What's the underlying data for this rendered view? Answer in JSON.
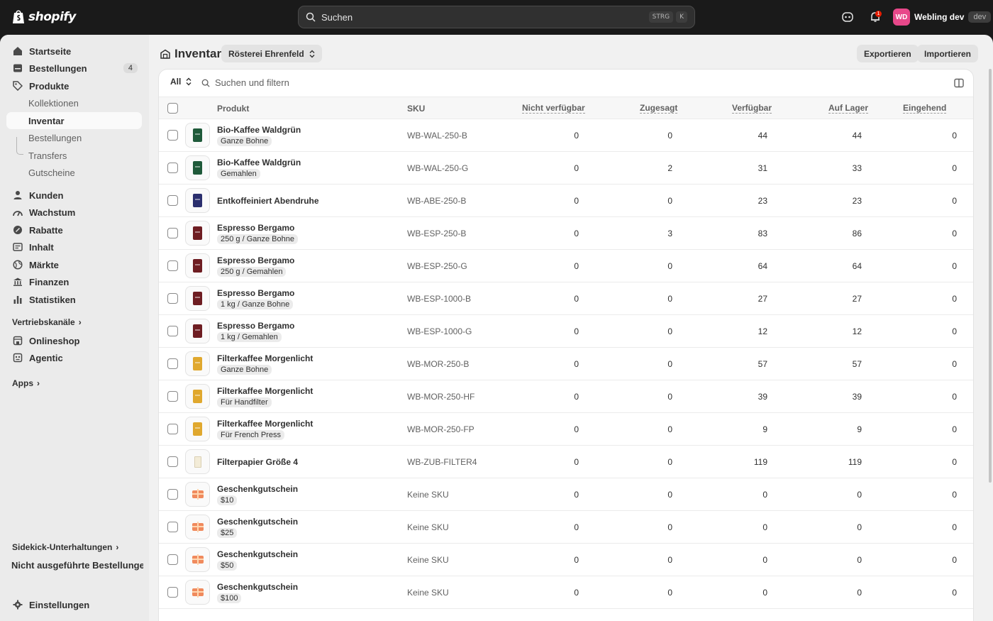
{
  "topbar": {
    "brand": "shopify",
    "search_placeholder": "Suchen",
    "shortcut_keys": [
      "STRG",
      "K"
    ],
    "notification_count": "1",
    "store_initials": "WD",
    "store_name": "Webling dev",
    "store_badge": "dev"
  },
  "sidebar": {
    "items": [
      {
        "label": "Startseite",
        "icon": "home-icon"
      },
      {
        "label": "Bestellungen",
        "icon": "orders-icon",
        "badge": "4"
      },
      {
        "label": "Produkte",
        "icon": "tag-icon"
      },
      {
        "label": "Kollektionen"
      },
      {
        "label": "Inventar"
      },
      {
        "label": "Bestellungen"
      },
      {
        "label": "Transfers"
      },
      {
        "label": "Gutscheine"
      },
      {
        "label": "Kunden",
        "icon": "person-icon"
      },
      {
        "label": "Wachstum",
        "icon": "growth-icon"
      },
      {
        "label": "Rabatte",
        "icon": "discount-icon"
      },
      {
        "label": "Inhalt",
        "icon": "content-icon"
      },
      {
        "label": "Märkte",
        "icon": "globe-icon"
      },
      {
        "label": "Finanzen",
        "icon": "bank-icon"
      },
      {
        "label": "Statistiken",
        "icon": "chart-icon"
      },
      {
        "label": "Onlineshop",
        "icon": "store-icon"
      },
      {
        "label": "Agentic",
        "icon": "agentic-icon"
      }
    ],
    "sales_channels_label": "Vertriebskanäle",
    "apps_label": "Apps",
    "sidekick_label": "Sidekick-Unterhaltungen",
    "sidekick_item": "Nicht ausgeführte Bestellungen ...",
    "settings_label": "Einstellungen"
  },
  "page": {
    "title": "Inventar",
    "location": "Rösterei Ehrenfeld",
    "export_label": "Exportieren",
    "import_label": "Importieren"
  },
  "filter": {
    "tab_label": "All",
    "search_placeholder": "Suchen und filtern"
  },
  "table": {
    "headers": {
      "product": "Produkt",
      "sku": "SKU",
      "unavailable": "Nicht verfügbar",
      "committed": "Zugesagt",
      "available": "Verfügbar",
      "on_hand": "Auf Lager",
      "incoming": "Eingehend"
    },
    "rows": [
      {
        "name": "Bio-Kaffee Waldgrün",
        "variant": "Ganze Bohne",
        "sku": "WB-WAL-250-B",
        "unavailable": "0",
        "committed": "0",
        "available": "44",
        "on_hand": "44",
        "incoming": "0",
        "thumb": "#1f5a3a"
      },
      {
        "name": "Bio-Kaffee Waldgrün",
        "variant": "Gemahlen",
        "sku": "WB-WAL-250-G",
        "unavailable": "0",
        "committed": "2",
        "available": "31",
        "on_hand": "33",
        "incoming": "0",
        "thumb": "#1f5a3a"
      },
      {
        "name": "Entkoffeiniert Abendruhe",
        "variant": "",
        "sku": "WB-ABE-250-B",
        "unavailable": "0",
        "committed": "0",
        "available": "23",
        "on_hand": "23",
        "incoming": "0",
        "thumb": "#2b2f6e"
      },
      {
        "name": "Espresso Bergamo",
        "variant": "250 g / Ganze Bohne",
        "sku": "WB-ESP-250-B",
        "unavailable": "0",
        "committed": "3",
        "available": "83",
        "on_hand": "86",
        "incoming": "0",
        "thumb": "#6e1d22"
      },
      {
        "name": "Espresso Bergamo",
        "variant": "250 g / Gemahlen",
        "sku": "WB-ESP-250-G",
        "unavailable": "0",
        "committed": "0",
        "available": "64",
        "on_hand": "64",
        "incoming": "0",
        "thumb": "#6e1d22"
      },
      {
        "name": "Espresso Bergamo",
        "variant": "1 kg / Ganze Bohne",
        "sku": "WB-ESP-1000-B",
        "unavailable": "0",
        "committed": "0",
        "available": "27",
        "on_hand": "27",
        "incoming": "0",
        "thumb": "#6e1d22"
      },
      {
        "name": "Espresso Bergamo",
        "variant": "1 kg / Gemahlen",
        "sku": "WB-ESP-1000-G",
        "unavailable": "0",
        "committed": "0",
        "available": "12",
        "on_hand": "12",
        "incoming": "0",
        "thumb": "#6e1d22"
      },
      {
        "name": "Filterkaffee Morgenlicht",
        "variant": "Ganze Bohne",
        "sku": "WB-MOR-250-B",
        "unavailable": "0",
        "committed": "0",
        "available": "57",
        "on_hand": "57",
        "incoming": "0",
        "thumb": "#e0a82e"
      },
      {
        "name": "Filterkaffee Morgenlicht",
        "variant": "Für Handfilter",
        "sku": "WB-MOR-250-HF",
        "unavailable": "0",
        "committed": "0",
        "available": "39",
        "on_hand": "39",
        "incoming": "0",
        "thumb": "#e0a82e"
      },
      {
        "name": "Filterkaffee Morgenlicht",
        "variant": "Für French Press",
        "sku": "WB-MOR-250-FP",
        "unavailable": "0",
        "committed": "0",
        "available": "9",
        "on_hand": "9",
        "incoming": "0",
        "thumb": "#e0a82e"
      },
      {
        "name": "Filterpapier Größe 4",
        "variant": "",
        "sku": "WB-ZUB-FILTER4",
        "unavailable": "0",
        "committed": "0",
        "available": "119",
        "on_hand": "119",
        "incoming": "0",
        "thumb": "paper"
      },
      {
        "name": "Geschenkgutschein",
        "variant": "$10",
        "sku": "Keine SKU",
        "unavailable": "0",
        "committed": "0",
        "available": "0",
        "on_hand": "0",
        "incoming": "0",
        "thumb": "gift"
      },
      {
        "name": "Geschenkgutschein",
        "variant": "$25",
        "sku": "Keine SKU",
        "unavailable": "0",
        "committed": "0",
        "available": "0",
        "on_hand": "0",
        "incoming": "0",
        "thumb": "gift"
      },
      {
        "name": "Geschenkgutschein",
        "variant": "$50",
        "sku": "Keine SKU",
        "unavailable": "0",
        "committed": "0",
        "available": "0",
        "on_hand": "0",
        "incoming": "0",
        "thumb": "gift"
      },
      {
        "name": "Geschenkgutschein",
        "variant": "$100",
        "sku": "Keine SKU",
        "unavailable": "0",
        "committed": "0",
        "available": "0",
        "on_hand": "0",
        "incoming": "0",
        "thumb": "gift"
      }
    ]
  }
}
